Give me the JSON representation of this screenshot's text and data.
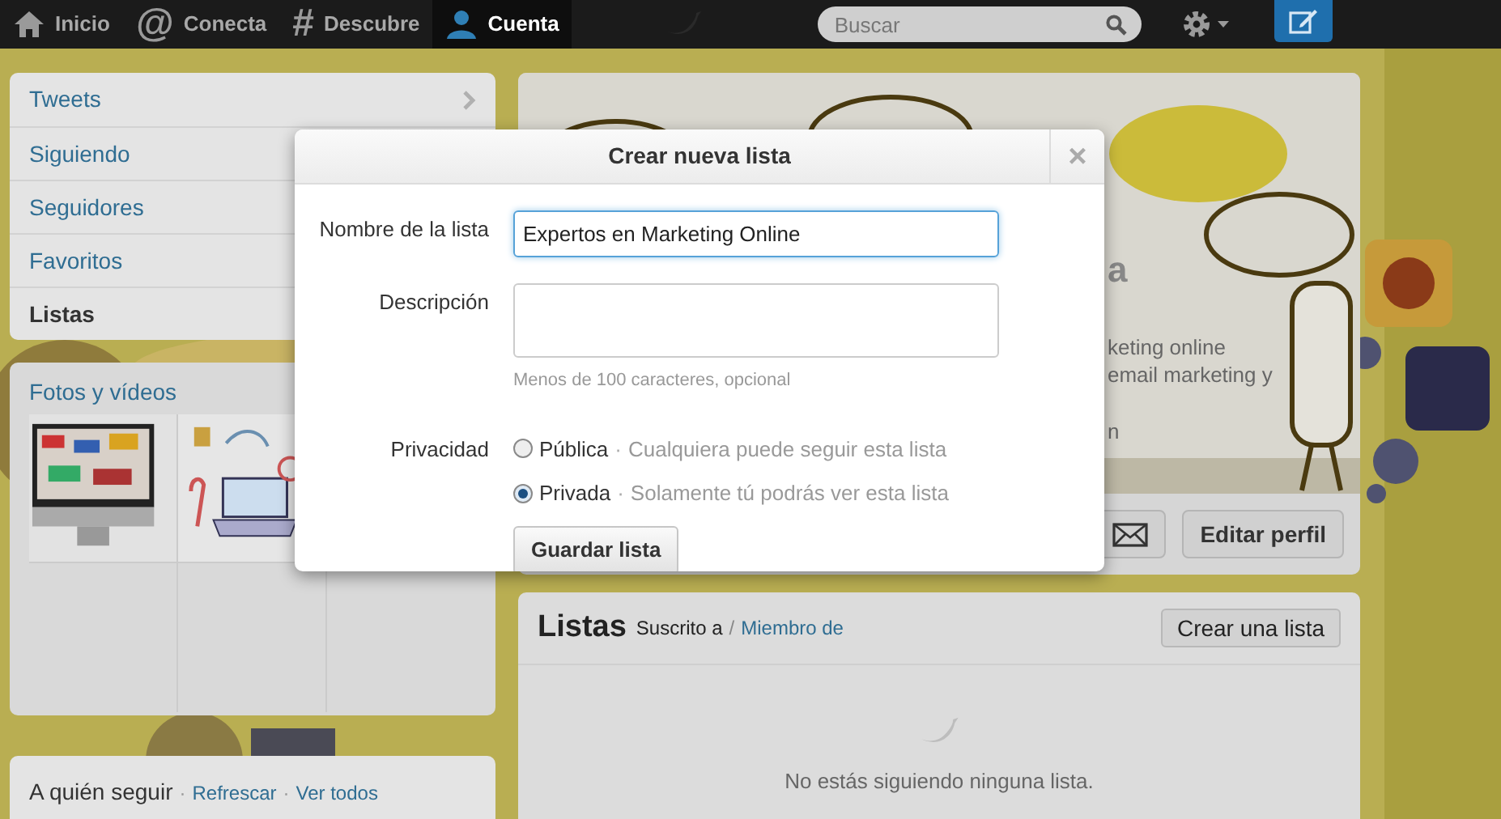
{
  "nav": {
    "items": [
      {
        "label": "Inicio",
        "kind": "svg",
        "selected": false
      },
      {
        "label": "Conecta",
        "kind": "glyph",
        "glyph": "@",
        "selected": false
      },
      {
        "label": "Descubre",
        "kind": "glyph",
        "glyph": "#",
        "selected": false
      },
      {
        "label": "Cuenta",
        "kind": "svg",
        "selected": true
      }
    ],
    "search": {
      "placeholder": "Buscar"
    }
  },
  "sidebar": {
    "items": [
      {
        "label": "Tweets",
        "selected": false
      },
      {
        "label": "Siguiendo",
        "selected": false
      },
      {
        "label": "Seguidores",
        "selected": false
      },
      {
        "label": "Favoritos",
        "selected": false
      },
      {
        "label": "Listas",
        "selected": true
      }
    ],
    "media_title": "Fotos y vídeos",
    "who_to_follow": {
      "title": "A quién seguir",
      "separator": "·",
      "links": [
        "Refrescar",
        "Ver todos"
      ]
    }
  },
  "profile": {
    "name_fragment": "a",
    "bio_fragments": [
      "keting online",
      "email marketing y",
      "n"
    ],
    "edit_button": "Editar perfil"
  },
  "lists": {
    "title": "Listas",
    "tabs": [
      {
        "label": "Suscrito a",
        "selected": true
      },
      {
        "label": "Miembro de",
        "selected": false
      }
    ],
    "separator": "/",
    "button": "Crear una lista",
    "empty": "No estás siguiendo ninguna lista."
  },
  "dialog": {
    "title": "Crear nueva lista",
    "close": "×",
    "name_label": "Nombre de la lista",
    "name_value": "Expertos en Marketing Online",
    "description_label": "Descripción",
    "description_hint": "Menos de 100 caracteres, opcional",
    "privacy_label": "Privacidad",
    "option_separator": "·",
    "options": [
      {
        "label": "Pública",
        "description": "Cualquiera puede seguir esta lista",
        "selected": false
      },
      {
        "label": "Privada",
        "description": "Solamente tú podrás ver esta lista",
        "selected": true
      }
    ],
    "submit": "Guardar lista"
  }
}
